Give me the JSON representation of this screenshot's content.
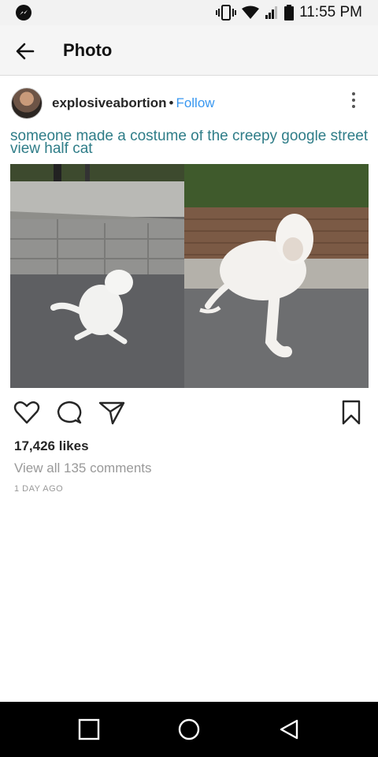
{
  "status_bar": {
    "time": "11:55 PM",
    "icons": [
      "messenger-icon",
      "vibrate-icon",
      "wifi-icon",
      "signal-icon",
      "battery-icon"
    ]
  },
  "app_bar": {
    "title": "Photo",
    "back_icon": "arrow-left-icon"
  },
  "post": {
    "username": "explosiveabortion",
    "separator": "•",
    "follow_label": "Follow",
    "follow_color": "#3897f0",
    "more_icon": "more-vertical-icon",
    "image_caption": "someone made a costume of the creepy google street view half cat",
    "actions": [
      "heart-icon",
      "comment-icon",
      "share-icon",
      "bookmark-icon"
    ],
    "likes": "17,426 likes",
    "comments_link": "View all 135 comments",
    "timestamp": "1 DAY AGO"
  },
  "nav_bar": {
    "icons": [
      "recents-square-icon",
      "home-circle-icon",
      "back-triangle-icon"
    ]
  }
}
